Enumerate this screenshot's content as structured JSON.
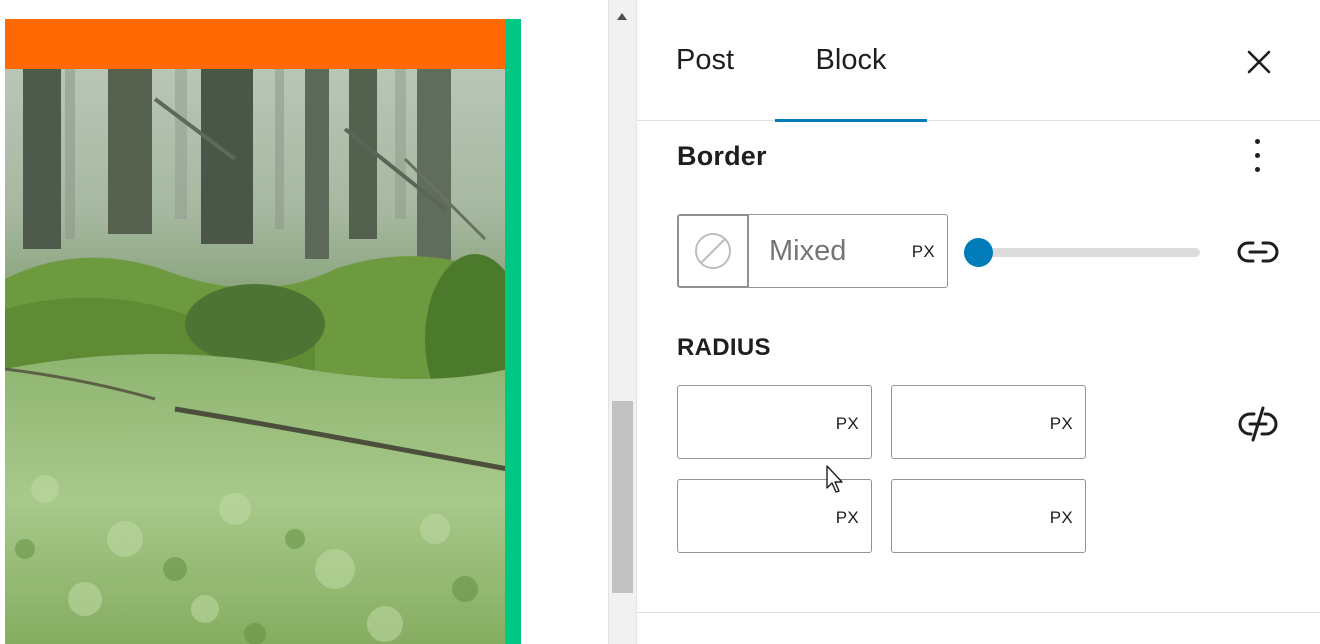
{
  "tabs": [
    {
      "label": "Post",
      "active": false
    },
    {
      "label": "Block",
      "active": true
    }
  ],
  "panel": {
    "title": "Border",
    "width": {
      "value": "",
      "placeholder": "Mixed",
      "unit": "PX"
    },
    "slider_value": 0,
    "radius": {
      "label": "RADIUS",
      "fields": [
        {
          "corner": "top-left",
          "value": "",
          "unit": "PX"
        },
        {
          "corner": "top-right",
          "value": "",
          "unit": "PX"
        },
        {
          "corner": "bottom-left",
          "value": "",
          "unit": "PX"
        },
        {
          "corner": "bottom-right",
          "value": "",
          "unit": "PX"
        }
      ]
    }
  },
  "icons": {
    "close": "close-icon",
    "options": "more-vertical-icon",
    "border_style": "no-border-style-icon",
    "link": "link-icon",
    "unlink": "unlink-icon"
  },
  "colors": {
    "accent": "#007cba",
    "image_top_bar": "#ff6900",
    "image_side_edge": "#00c783"
  }
}
